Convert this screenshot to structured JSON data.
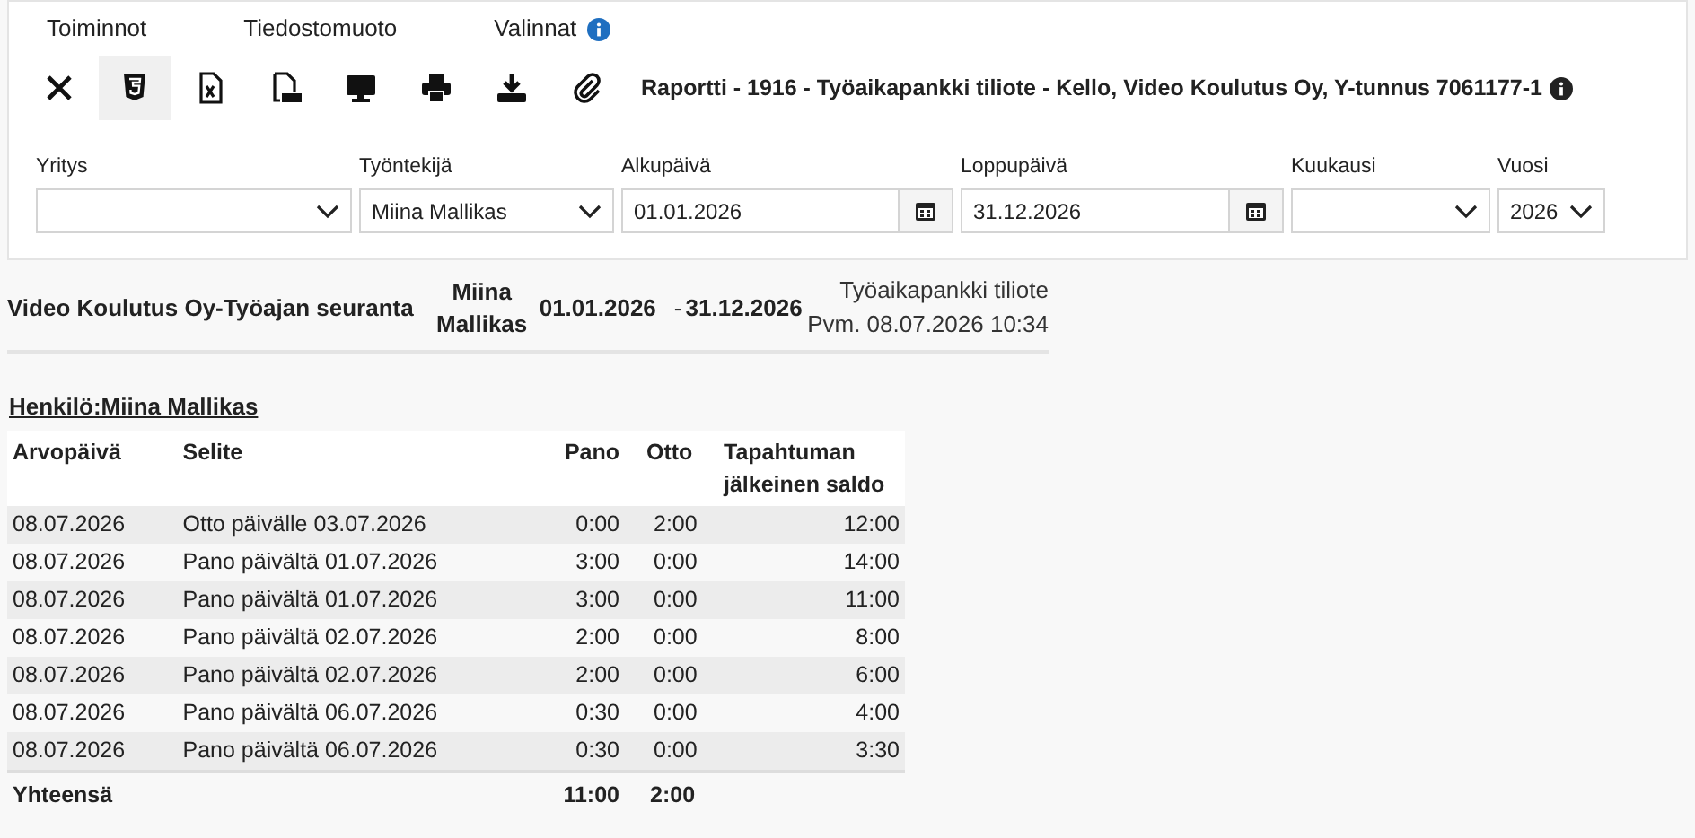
{
  "menu": [
    {
      "label": "Toiminnot",
      "info": false
    },
    {
      "label": "Tiedostomuoto",
      "info": false
    },
    {
      "label": "Valinnat",
      "info": true
    }
  ],
  "toolbar": [
    {
      "kind": "close",
      "selected": false
    },
    {
      "kind": "html",
      "selected": true
    },
    {
      "kind": "excel",
      "selected": false
    },
    {
      "kind": "pdf",
      "selected": false
    },
    {
      "kind": "screen",
      "selected": false
    },
    {
      "kind": "print",
      "selected": false
    },
    {
      "kind": "download",
      "selected": false
    },
    {
      "kind": "attach",
      "selected": false
    }
  ],
  "report_title": "Raportti - 1916 - Työaikapankki tiliote - Kello, Video Koulutus Oy, Y-tunnus 7061177-1",
  "filters": [
    {
      "label": "Yritys",
      "kind": "select"
    },
    {
      "label": "Työntekijä",
      "kind": "select",
      "value": "Miina Mallikas"
    },
    {
      "label": "Alkupäivä",
      "kind": "date",
      "value": "01.01.2026"
    },
    {
      "label": "Loppupäivä",
      "kind": "date",
      "value": "31.12.2026"
    },
    {
      "label": "Kuukausi",
      "kind": "select"
    },
    {
      "label": "Vuosi",
      "kind": "select",
      "value": "2026"
    }
  ],
  "report_header": {
    "company": "Video Koulutus Oy-Työajan seuranta",
    "employee": "Miina Mallikas",
    "start": "01.01.2026",
    "dash": "-",
    "end": "31.12.2026",
    "report_name": "Työaikapankki tiliote",
    "date": "Pvm. 08.07.2026 10:34"
  },
  "person": "Henkilö:Miina Mallikas",
  "table": {
    "columns": [
      "Arvopäivä",
      "Selite",
      "Pano",
      "Otto",
      "Tapahtuman jälkeinen saldo"
    ],
    "rows": [
      [
        "08.07.2026",
        "Otto päivälle 03.07.2026",
        "0:00",
        "2:00",
        "12:00"
      ],
      [
        "08.07.2026",
        "Pano päivältä 01.07.2026",
        "3:00",
        "0:00",
        "14:00"
      ],
      [
        "08.07.2026",
        "Pano päivältä 01.07.2026",
        "3:00",
        "0:00",
        "11:00"
      ],
      [
        "08.07.2026",
        "Pano päivältä 02.07.2026",
        "2:00",
        "0:00",
        "8:00"
      ],
      [
        "08.07.2026",
        "Pano päivältä 02.07.2026",
        "2:00",
        "0:00",
        "6:00"
      ],
      [
        "08.07.2026",
        "Pano päivältä 06.07.2026",
        "0:30",
        "0:00",
        "4:00"
      ],
      [
        "08.07.2026",
        "Pano päivältä 06.07.2026",
        "0:30",
        "0:00",
        "3:30"
      ]
    ],
    "total": {
      "label": "Yhteensä",
      "pano": "11:00",
      "otto": "2:00"
    }
  }
}
